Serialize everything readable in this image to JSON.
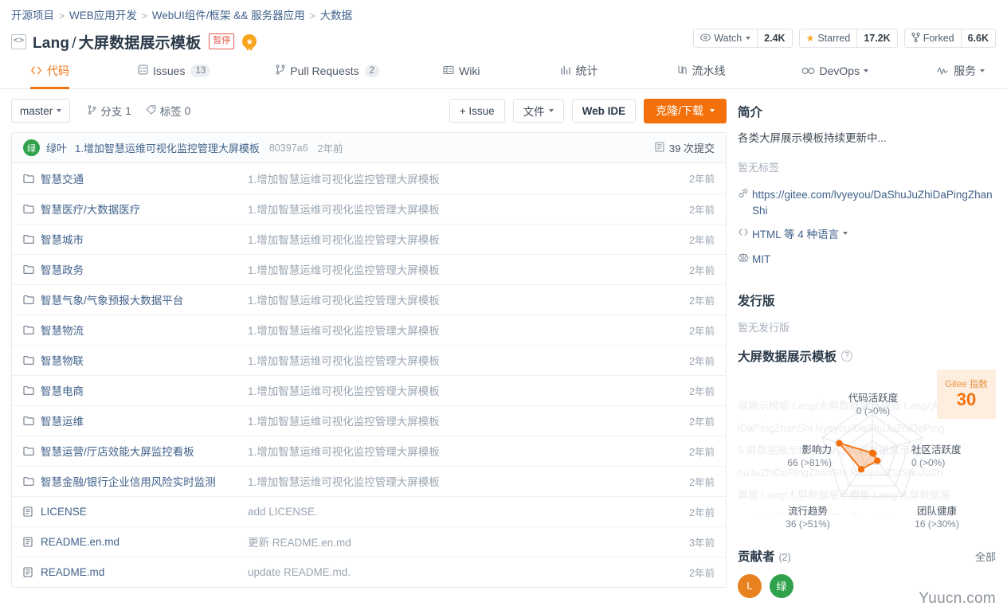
{
  "breadcrumb": {
    "items": [
      "开源项目",
      "WEB应用开发",
      "WebUI组件/框架 && 服务器应用",
      "大数据"
    ],
    "separator": ">"
  },
  "header": {
    "repo_icon": "code-repo-icon",
    "owner": "Lang",
    "slash": "/",
    "repo_name": "大屏数据展示模板",
    "status_badge": "暂停",
    "medal_icon": "★"
  },
  "social": [
    {
      "icon": "eye-icon",
      "glyph": "👁",
      "label": "Watch",
      "has_caret": true,
      "count": "2.4K"
    },
    {
      "icon": "star-icon",
      "glyph": "★",
      "label": "Starred",
      "has_caret": false,
      "count": "17.2K"
    },
    {
      "icon": "fork-icon",
      "glyph": "⑂",
      "label": "Forked",
      "has_caret": false,
      "count": "6.6K"
    }
  ],
  "nav": {
    "tabs": [
      {
        "label": "代码",
        "icon": "code-icon",
        "glyph": "&lt;/&gt;",
        "active": true,
        "badge": ""
      },
      {
        "label": "Issues",
        "icon": "issues-icon",
        "glyph": "▤",
        "active": false,
        "badge": "13"
      },
      {
        "label": "Pull Requests",
        "icon": "pull-request-icon",
        "glyph": "⑃",
        "active": false,
        "badge": "2"
      },
      {
        "label": "Wiki",
        "icon": "wiki-icon",
        "glyph": "▤",
        "active": false,
        "badge": ""
      },
      {
        "label": "统计",
        "icon": "chart-icon",
        "glyph": "▥",
        "active": false,
        "badge": ""
      },
      {
        "label": "流水线",
        "icon": "pipeline-icon",
        "glyph": "Ⲅ",
        "active": false,
        "badge": ""
      },
      {
        "label": "DevOps",
        "icon": "infinity-icon",
        "glyph": "∞",
        "active": false,
        "badge": "",
        "caret": true
      },
      {
        "label": "服务",
        "icon": "pulse-icon",
        "glyph": "∿",
        "active": false,
        "badge": "",
        "caret": true
      }
    ]
  },
  "toolbar": {
    "branch": "master",
    "branches_icon": "branch-icon",
    "branches_label": "分支",
    "branches_count": "1",
    "tags_icon": "tag-icon",
    "tags_label": "标签",
    "tags_count": "0",
    "issue_button": "+ Issue",
    "files_button": "文件",
    "webide_button": "Web IDE",
    "clone_button": "克隆/下载"
  },
  "commit_bar": {
    "avatar_initial": "绿",
    "author": "绿叶",
    "message": "1.增加智慧运维可视化监控管理大屏模板",
    "sha": "80397a6",
    "time": "2年前",
    "commits_icon": "commits-icon",
    "commits_label": "39 次提交"
  },
  "files": {
    "rows": [
      {
        "type": "folder",
        "name": "智慧交通",
        "message": "1.增加智慧运维可视化监控管理大屏模板",
        "time": "2年前"
      },
      {
        "type": "folder",
        "name": "智慧医疗/大数据医疗",
        "message": "1.增加智慧运维可视化监控管理大屏模板",
        "time": "2年前"
      },
      {
        "type": "folder",
        "name": "智慧城市",
        "message": "1.增加智慧运维可视化监控管理大屏模板",
        "time": "2年前"
      },
      {
        "type": "folder",
        "name": "智慧政务",
        "message": "1.增加智慧运维可视化监控管理大屏模板",
        "time": "2年前"
      },
      {
        "type": "folder",
        "name": "智慧气象/气象预报大数据平台",
        "message": "1.增加智慧运维可视化监控管理大屏模板",
        "time": "2年前"
      },
      {
        "type": "folder",
        "name": "智慧物流",
        "message": "1.增加智慧运维可视化监控管理大屏模板",
        "time": "2年前"
      },
      {
        "type": "folder",
        "name": "智慧物联",
        "message": "1.增加智慧运维可视化监控管理大屏模板",
        "time": "2年前"
      },
      {
        "type": "folder",
        "name": "智慧电商",
        "message": "1.增加智慧运维可视化监控管理大屏模板",
        "time": "2年前"
      },
      {
        "type": "folder",
        "name": "智慧运维",
        "message": "1.增加智慧运维可视化监控管理大屏模板",
        "time": "2年前"
      },
      {
        "type": "folder",
        "name": "智慧运营/厅店效能大屏监控看板",
        "message": "1.增加智慧运维可视化监控管理大屏模板",
        "time": "2年前"
      },
      {
        "type": "folder",
        "name": "智慧金融/银行企业信用风险实时监测",
        "message": "1.增加智慧运维可视化监控管理大屏模板",
        "time": "2年前"
      },
      {
        "type": "file",
        "name": "LICENSE",
        "message": "add LICENSE.",
        "time": "2年前"
      },
      {
        "type": "file",
        "name": "README.en.md",
        "message": "更新 README.en.md",
        "time": "3年前"
      },
      {
        "type": "file",
        "name": "README.md",
        "message": "update README.md.",
        "time": "2年前"
      }
    ]
  },
  "sidebar": {
    "intro_title": "简介",
    "intro_text": "各类大屏展示模板持续更新中...",
    "no_tags": "暂无标签",
    "homepage_icon": "link-icon",
    "homepage": "https://gitee.com/lvyeyou/DaShuJuZhiDaPingZhanShi",
    "language_icon": "code-icon",
    "language": "HTML 等 4 种语言",
    "license_icon": "scale-icon",
    "license": "MIT",
    "releases_title": "发行版",
    "no_releases": "暂无发行版",
    "contributors_title": "贡献者",
    "contributors_count": "(2)",
    "contributors_all": "全部",
    "contributors": [
      {
        "initial": "L",
        "color": "#e8821e"
      },
      {
        "initial": "绿",
        "color": "#31a24c"
      }
    ]
  },
  "chart_data": {
    "type": "radar",
    "title": "大屏数据展示模板",
    "help_icon": "help-icon",
    "gitee_index_label": "Gitee 指数",
    "gitee_index_value": "30",
    "max": 100,
    "axes": [
      {
        "label": "代码活跃度",
        "value": 0,
        "percentile": "0 (>0%)"
      },
      {
        "label": "社区活跃度",
        "value": 0,
        "percentile": "0 (>0%)"
      },
      {
        "label": "团队健康",
        "value": 16,
        "percentile": "16 (>30%)"
      },
      {
        "label": "流行趋势",
        "value": 36,
        "percentile": "36 (>51%)"
      },
      {
        "label": "影响力",
        "value": 66,
        "percentile": "66 (>81%)"
      }
    ],
    "accent_color": "#f4700b",
    "grid_color": "#e2e5e9"
  },
  "watermark": {
    "site": "Yuucn.com",
    "bg_lines": [
      "据展示模板 Lang/大屏数据展示模板 Lang/大",
      "iDaPingZhanShi lvyeyou/DaShuJuZhiDaPing",
      "9   屏数据展示模板 Lang/大屏数据展示模板",
      "huJuZhiDaPingZhanShi lvyeyou/DaShuJuZh",
      "屏板 Lang/大屏数据展示模板 Lang/大屏数据展",
      "you/D  aShuJuZhiDaPingZhanShi  lvyeyou/DaS"
    ]
  }
}
